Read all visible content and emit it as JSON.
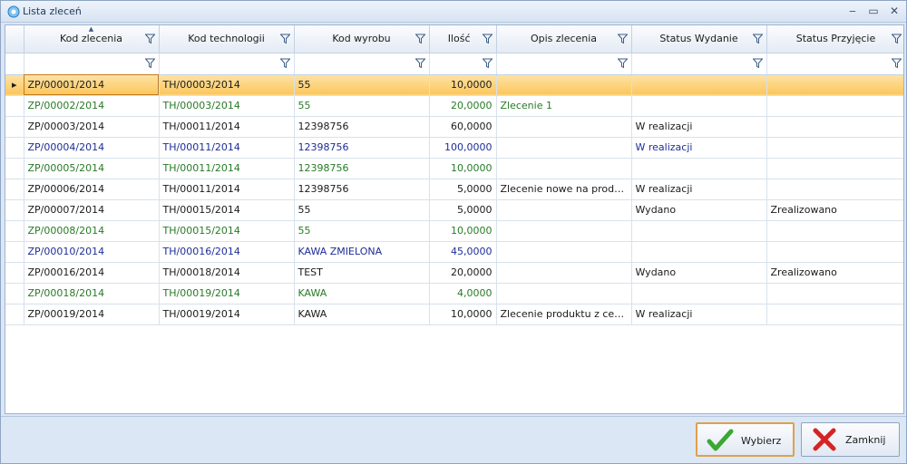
{
  "window": {
    "title": "Lista zleceń",
    "minimize": "‒",
    "restore": "▭",
    "close": "✕"
  },
  "grid": {
    "columns": [
      "Kod zlecenia",
      "Kod technologii",
      "Kod wyrobu",
      "Ilość",
      "Opis zlecenia",
      "Status Wydanie",
      "Status Przyjęcie"
    ],
    "sort_indicator": "▲",
    "row_indicator": "▸",
    "rows": [
      {
        "style": "sel",
        "cells": [
          "ZP/00001/2014",
          "TH/00003/2014",
          "55",
          "10,0000",
          "",
          "",
          ""
        ]
      },
      {
        "style": "green",
        "cells": [
          "ZP/00002/2014",
          "TH/00003/2014",
          "55",
          "20,0000",
          "Zlecenie 1",
          "",
          ""
        ]
      },
      {
        "style": "black",
        "cells": [
          "ZP/00003/2014",
          "TH/00011/2014",
          "12398756",
          "60,0000",
          "",
          "W realizacji",
          ""
        ]
      },
      {
        "style": "blue",
        "cells": [
          "ZP/00004/2014",
          "TH/00011/2014",
          "12398756",
          "100,0000",
          "",
          "W realizacji",
          ""
        ]
      },
      {
        "style": "green",
        "cells": [
          "ZP/00005/2014",
          "TH/00011/2014",
          "12398756",
          "10,0000",
          "",
          "",
          ""
        ]
      },
      {
        "style": "black",
        "cells": [
          "ZP/00006/2014",
          "TH/00011/2014",
          "12398756",
          "5,0000",
          "Zlecenie nowe na produkcj...",
          "W realizacji",
          ""
        ]
      },
      {
        "style": "black",
        "cells": [
          "ZP/00007/2014",
          "TH/00015/2014",
          "55",
          "5,0000",
          "",
          "Wydano",
          "Zrealizowano"
        ]
      },
      {
        "style": "green",
        "cells": [
          "ZP/00008/2014",
          "TH/00015/2014",
          "55",
          "10,0000",
          "",
          "",
          ""
        ]
      },
      {
        "style": "blue",
        "cells": [
          "ZP/00010/2014",
          "TH/00016/2014",
          "KAWA ZMIELONA",
          "45,0000",
          "",
          "",
          ""
        ]
      },
      {
        "style": "black",
        "cells": [
          "ZP/00016/2014",
          "TH/00018/2014",
          "TEST",
          "20,0000",
          "",
          "Wydano",
          "Zrealizowano"
        ]
      },
      {
        "style": "green",
        "cells": [
          "ZP/00018/2014",
          "TH/00019/2014",
          "KAWA",
          "4,0000",
          "",
          "",
          ""
        ]
      },
      {
        "style": "black",
        "cells": [
          "ZP/00019/2014",
          "TH/00019/2014",
          "KAWA",
          "10,0000",
          "Zlecenie produktu z cechą",
          "W realizacji",
          ""
        ]
      }
    ]
  },
  "buttons": {
    "select_label": "Wybierz",
    "close_label": "Zamknij"
  },
  "colors": {
    "selected_row": "#fcc65c",
    "green_text": "#287a28",
    "blue_text": "#1e2d96",
    "ok_icon": "#3aa832",
    "cancel_icon": "#d42424"
  },
  "icons": {
    "title": "app-logo-icon",
    "filter": "filter-funnel-icon",
    "select": "green-checkmark-icon",
    "close": "red-x-icon"
  }
}
